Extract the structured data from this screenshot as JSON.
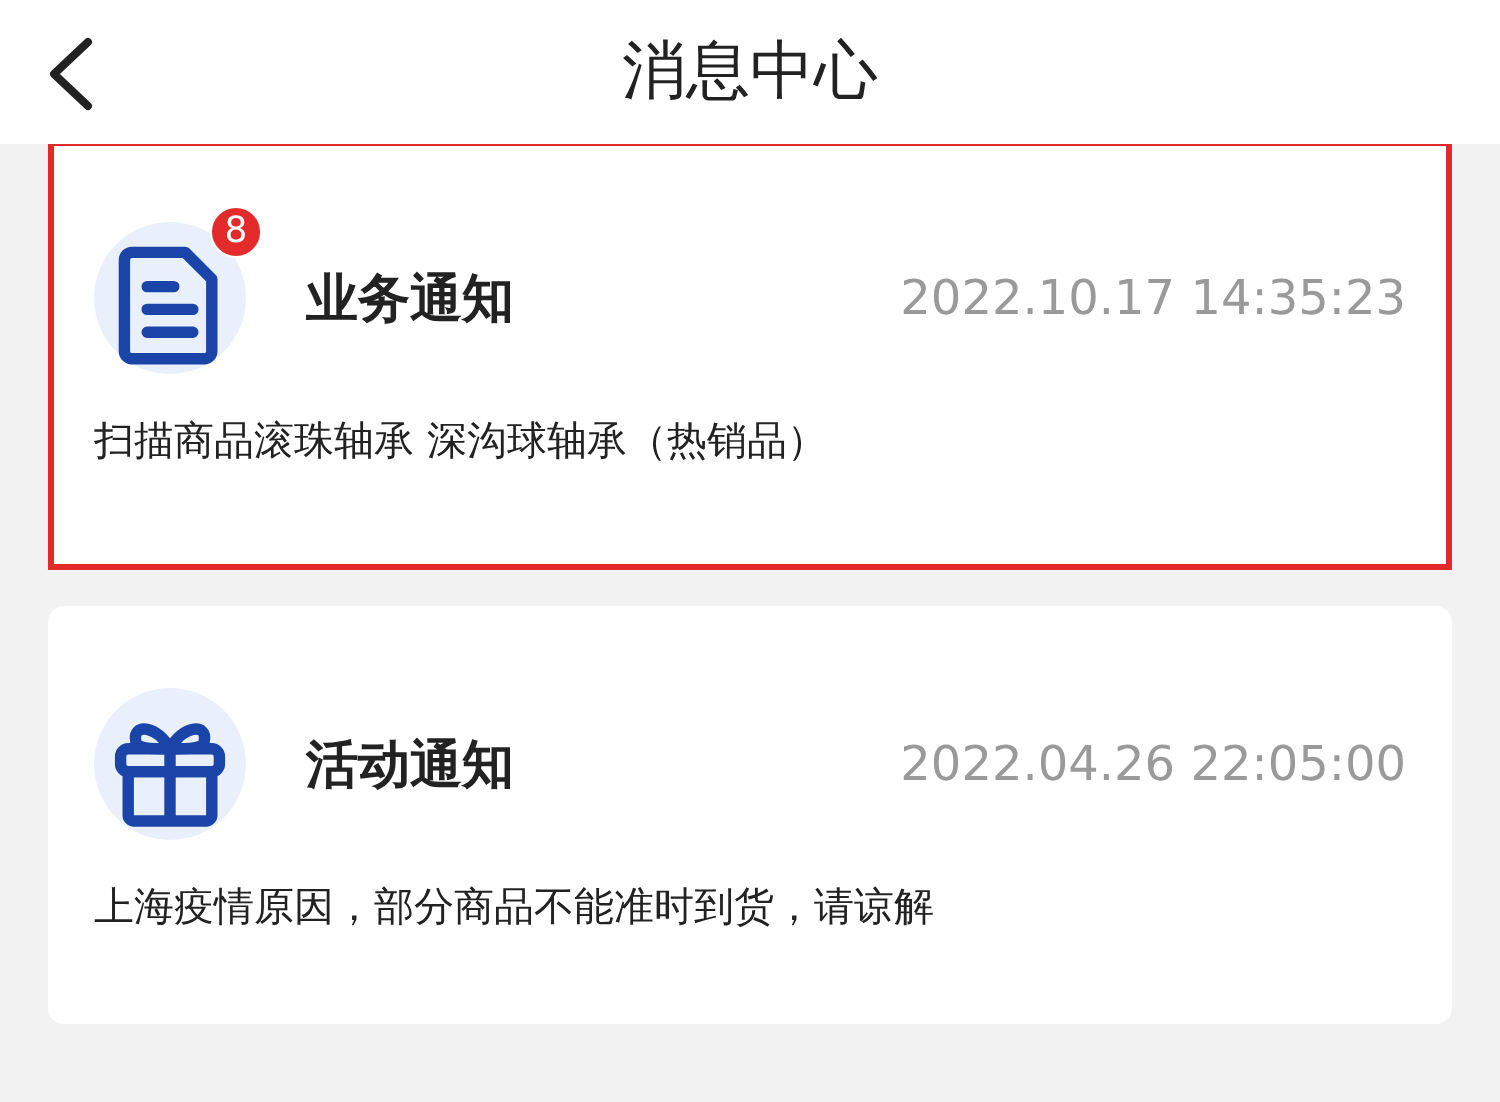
{
  "header": {
    "title": "消息中心"
  },
  "messages": [
    {
      "kind": "document",
      "title": "业务通知",
      "badge": "8",
      "time": "2022.10.17 14:35:23",
      "text": "扫描商品滚珠轴承 深沟球轴承（热销品）",
      "highlighted": true
    },
    {
      "kind": "gift",
      "title": "活动通知",
      "time": "2022.04.26 22:05:00",
      "text": "上海疫情原因，部分商品不能准时到货，请谅解",
      "highlighted": false
    }
  ]
}
